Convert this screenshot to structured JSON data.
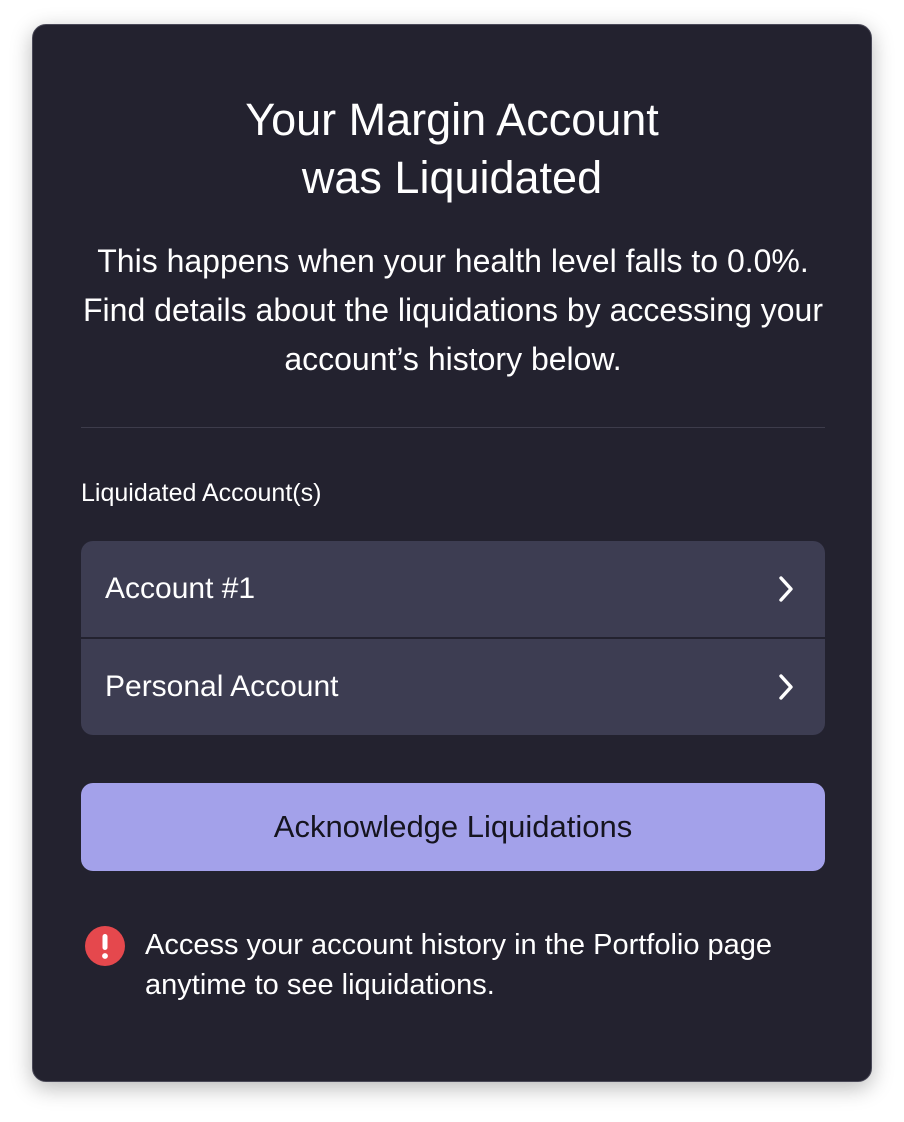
{
  "modal": {
    "title_line1": "Your Margin Account",
    "title_line2": "was Liquidated",
    "description": "This happens when your health level falls to 0.0%. Find details about the liquidations by accessing your account’s history below.",
    "section_label": "Liquidated Account(s)",
    "accounts": [
      {
        "name": "Account #1",
        "icon": "chevron-right-icon"
      },
      {
        "name": "Personal Account",
        "icon": "chevron-right-icon"
      }
    ],
    "acknowledge_label": "Acknowledge Liquidations",
    "notice": {
      "icon": "alert-icon",
      "text": "Access your account history in the Portfolio page anytime to see liquidations."
    }
  },
  "colors": {
    "modal_bg": "#23222f",
    "account_row_bg": "#3d3d52",
    "button_bg": "#a3a1ea",
    "alert_red": "#e5484d"
  }
}
